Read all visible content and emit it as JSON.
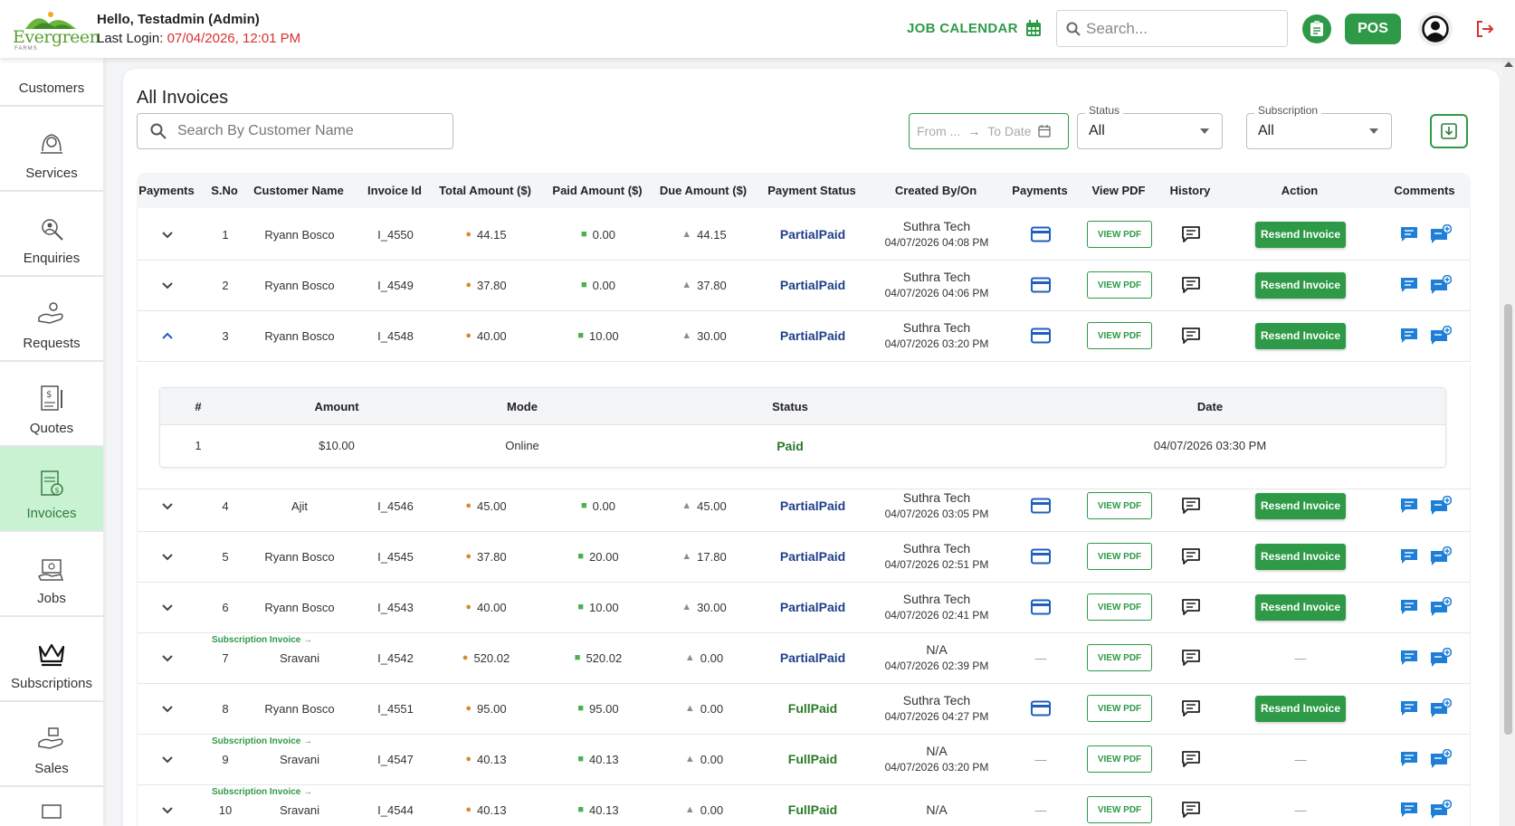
{
  "header": {
    "logo_text": "Evergreen",
    "logo_sub": "FARMS",
    "greeting": "Hello, Testadmin (Admin)",
    "last_login_label": "Last Login: ",
    "last_login_value": "07/04/2026, 12:01 PM",
    "job_calendar": "JOB CALENDAR",
    "search_placeholder": "Search...",
    "pos": "POS"
  },
  "sidebar": {
    "items": [
      {
        "label": "Customers",
        "icon": "customers-icon"
      },
      {
        "label": "Services",
        "icon": "services-icon"
      },
      {
        "label": "Enquiries",
        "icon": "enquiries-icon"
      },
      {
        "label": "Requests",
        "icon": "requests-icon"
      },
      {
        "label": "Quotes",
        "icon": "quotes-icon"
      },
      {
        "label": "Invoices",
        "icon": "invoices-icon",
        "active": true
      },
      {
        "label": "Jobs",
        "icon": "jobs-icon"
      },
      {
        "label": "Subscriptions",
        "icon": "crown-icon"
      },
      {
        "label": "Sales",
        "icon": "sales-icon"
      }
    ]
  },
  "page": {
    "title": "All Invoices",
    "search_placeholder": "Search By Customer Name",
    "from_placeholder": "From ...",
    "to_placeholder": "To Date",
    "status_legend": "Status",
    "status_value": "All",
    "subscription_legend": "Subscription",
    "subscription_value": "All"
  },
  "colors": {
    "accent": "#2e9a47",
    "partial": "#1f3f8a",
    "full": "#2b7a2b",
    "active_bg": "#c9f2d2"
  },
  "table": {
    "columns": [
      "Payments",
      "S.No",
      "Customer Name",
      "Invoice Id",
      "Total Amount ($)",
      "Paid Amount ($)",
      "Due Amount ($)",
      "Payment Status",
      "Created By/On",
      "Payments",
      "View PDF",
      "History",
      "Action",
      "Comments"
    ],
    "view_pdf_label": "VIEW PDF",
    "resend_label": "Resend Invoice",
    "subscription_tag": "Subscription Invoice →",
    "rows": [
      {
        "sno": "1",
        "customer": "Ryann Bosco",
        "invoice": "I_4550",
        "total": "44.15",
        "paid": "0.00",
        "due": "44.15",
        "status": "PartialPaid",
        "created_by": "Suthra Tech",
        "created_on": "04/07/2026 04:08 PM",
        "sub": false
      },
      {
        "sno": "2",
        "customer": "Ryann Bosco",
        "invoice": "I_4549",
        "total": "37.80",
        "paid": "0.00",
        "due": "37.80",
        "status": "PartialPaid",
        "created_by": "Suthra Tech",
        "created_on": "04/07/2026 04:06 PM",
        "sub": false
      },
      {
        "sno": "3",
        "customer": "Ryann Bosco",
        "invoice": "I_4548",
        "total": "40.00",
        "paid": "10.00",
        "due": "30.00",
        "status": "PartialPaid",
        "created_by": "Suthra Tech",
        "created_on": "04/07/2026 03:20 PM",
        "sub": false,
        "expanded": true
      },
      {
        "sno": "4",
        "customer": "Ajit",
        "invoice": "I_4546",
        "total": "45.00",
        "paid": "0.00",
        "due": "45.00",
        "status": "PartialPaid",
        "created_by": "Suthra Tech",
        "created_on": "04/07/2026 03:05 PM",
        "sub": false
      },
      {
        "sno": "5",
        "customer": "Ryann Bosco",
        "invoice": "I_4545",
        "total": "37.80",
        "paid": "20.00",
        "due": "17.80",
        "status": "PartialPaid",
        "created_by": "Suthra Tech",
        "created_on": "04/07/2026 02:51 PM",
        "sub": false
      },
      {
        "sno": "6",
        "customer": "Ryann Bosco",
        "invoice": "I_4543",
        "total": "40.00",
        "paid": "10.00",
        "due": "30.00",
        "status": "PartialPaid",
        "created_by": "Suthra Tech",
        "created_on": "04/07/2026 02:41 PM",
        "sub": false
      },
      {
        "sno": "7",
        "customer": "Sravani",
        "invoice": "I_4542",
        "total": "520.02",
        "paid": "520.02",
        "due": "0.00",
        "status": "PartialPaid",
        "created_by": "N/A",
        "created_on": "04/07/2026 02:39 PM",
        "sub": true
      },
      {
        "sno": "8",
        "customer": "Ryann Bosco",
        "invoice": "I_4551",
        "total": "95.00",
        "paid": "95.00",
        "due": "0.00",
        "status": "FullPaid",
        "created_by": "Suthra Tech",
        "created_on": "04/07/2026 04:27 PM",
        "sub": false
      },
      {
        "sno": "9",
        "customer": "Sravani",
        "invoice": "I_4547",
        "total": "40.13",
        "paid": "40.13",
        "due": "0.00",
        "status": "FullPaid",
        "created_by": "N/A",
        "created_on": "04/07/2026 03:20 PM",
        "sub": true
      },
      {
        "sno": "10",
        "customer": "Sravani",
        "invoice": "I_4544",
        "total": "40.13",
        "paid": "40.13",
        "due": "0.00",
        "status": "FullPaid",
        "created_by": "N/A",
        "created_on": "",
        "sub": true
      }
    ],
    "payments_subtable": {
      "columns": [
        "#",
        "Amount",
        "Mode",
        "Status",
        "Date"
      ],
      "rows": [
        {
          "num": "1",
          "amount": "$10.00",
          "mode": "Online",
          "status": "Paid",
          "date": "04/07/2026 03:30 PM"
        }
      ]
    }
  }
}
